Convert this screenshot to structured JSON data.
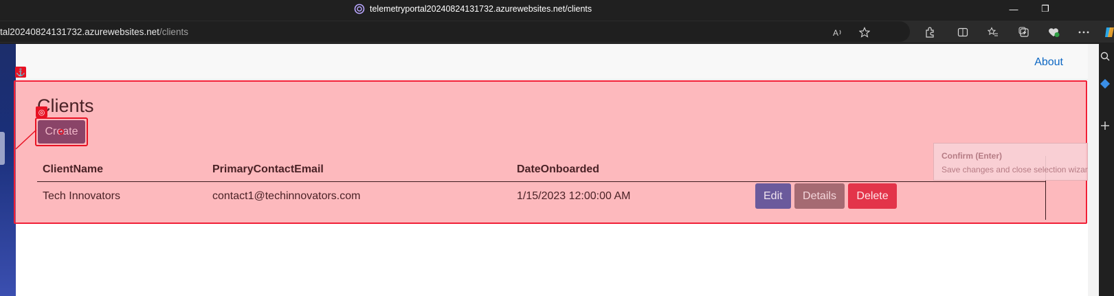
{
  "window": {
    "title": "telemetryportal20240824131732.azurewebsites.net/clients"
  },
  "addressbar": {
    "url_host": "tal20240824131732.azurewebsites.net",
    "url_path": "/clients"
  },
  "nav": {
    "about_label": "About"
  },
  "main": {
    "heading": "Clients",
    "create_label": "Create",
    "table": {
      "headers": [
        "ClientName",
        "PrimaryContactEmail",
        "DateOnboarded"
      ],
      "rows": [
        {
          "client_name": "Tech Innovators",
          "email": "contact1@techinnovators.com",
          "date": "1/15/2023 12:00:00 AM",
          "actions": [
            "Edit",
            "Details",
            "Delete"
          ]
        }
      ]
    }
  },
  "tooltip": {
    "title": "Confirm (Enter)",
    "text": "Save changes and close selection wizar"
  },
  "colors": {
    "overlay": "#fc7880",
    "overlay_border": "#f11f36",
    "link": "#0b66c3"
  },
  "icons": [
    "edge-logo-icon",
    "minimize-icon",
    "restore-icon",
    "read-aloud-icon",
    "favorite-star-icon",
    "extensions-icon",
    "split-screen-icon",
    "favorites-icon",
    "collections-icon",
    "browser-essentials-icon",
    "more-icon",
    "copilot-icon",
    "anchor-icon",
    "target-icon"
  ]
}
